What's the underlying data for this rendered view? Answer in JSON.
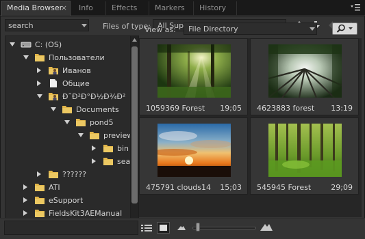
{
  "tabs": [
    {
      "label": "Media Browser",
      "active": true,
      "close": "×"
    },
    {
      "label": "Info",
      "active": false
    },
    {
      "label": "Effects",
      "active": false
    },
    {
      "label": "Markers",
      "active": false
    },
    {
      "label": "History",
      "active": false
    }
  ],
  "toolbar": {
    "search_value": "search",
    "filetype_label": "Files of type:",
    "filetype_value": "All Supported Files"
  },
  "tree": [
    {
      "label": "C: (OS)",
      "icon": "drive-icon",
      "expanded": true,
      "indent": 0
    },
    {
      "label": "Пользователи",
      "icon": "folder-icon",
      "expanded": true,
      "indent": 1
    },
    {
      "label": "Иванов",
      "icon": "user-folder-icon",
      "expanded": false,
      "indent": 2
    },
    {
      "label": "Общие",
      "icon": "document-icon",
      "expanded": false,
      "indent": 2
    },
    {
      "label": "Ð˜Ð²Ð°Ð½Ð¾Ð²",
      "icon": "user-folder-icon",
      "expanded": true,
      "indent": 2
    },
    {
      "label": "Documents",
      "icon": "folder-icon",
      "expanded": true,
      "indent": 3
    },
    {
      "label": "pond5",
      "icon": "folder-icon",
      "expanded": true,
      "indent": 4
    },
    {
      "label": "preview",
      "icon": "folder-icon",
      "expanded": true,
      "indent": 5
    },
    {
      "label": "bin",
      "icon": "folder-icon",
      "expanded": false,
      "indent": 6
    },
    {
      "label": "sear",
      "icon": "folder-icon",
      "expanded": false,
      "indent": 6
    },
    {
      "label": "??????",
      "icon": "folder-icon",
      "expanded": false,
      "indent": 2
    },
    {
      "label": "ATI",
      "icon": "folder-icon",
      "expanded": false,
      "indent": 1
    },
    {
      "label": "eSupport",
      "icon": "folder-icon",
      "expanded": false,
      "indent": 1
    },
    {
      "label": "FieldsKit3AEManual",
      "icon": "folder-icon",
      "expanded": false,
      "indent": 1
    }
  ],
  "view": {
    "label": "View as:",
    "value": "File Directory"
  },
  "thumbnails": [
    {
      "name": "1059369 Forest",
      "duration": "19;05",
      "scene": "forest-sunbeams"
    },
    {
      "name": "4623883 forest",
      "duration": "13:19",
      "scene": "forest-canopy-up"
    },
    {
      "name": "475791 clouds14",
      "duration": "15;03",
      "scene": "sunset-clouds"
    },
    {
      "name": "545945 Forest",
      "duration": "29;09",
      "scene": "green-forest"
    }
  ],
  "zoom": {
    "level": 0.05
  },
  "colors": {
    "panel": "#343434",
    "folder": "#e2b64a",
    "text": "#d4d4d4"
  }
}
